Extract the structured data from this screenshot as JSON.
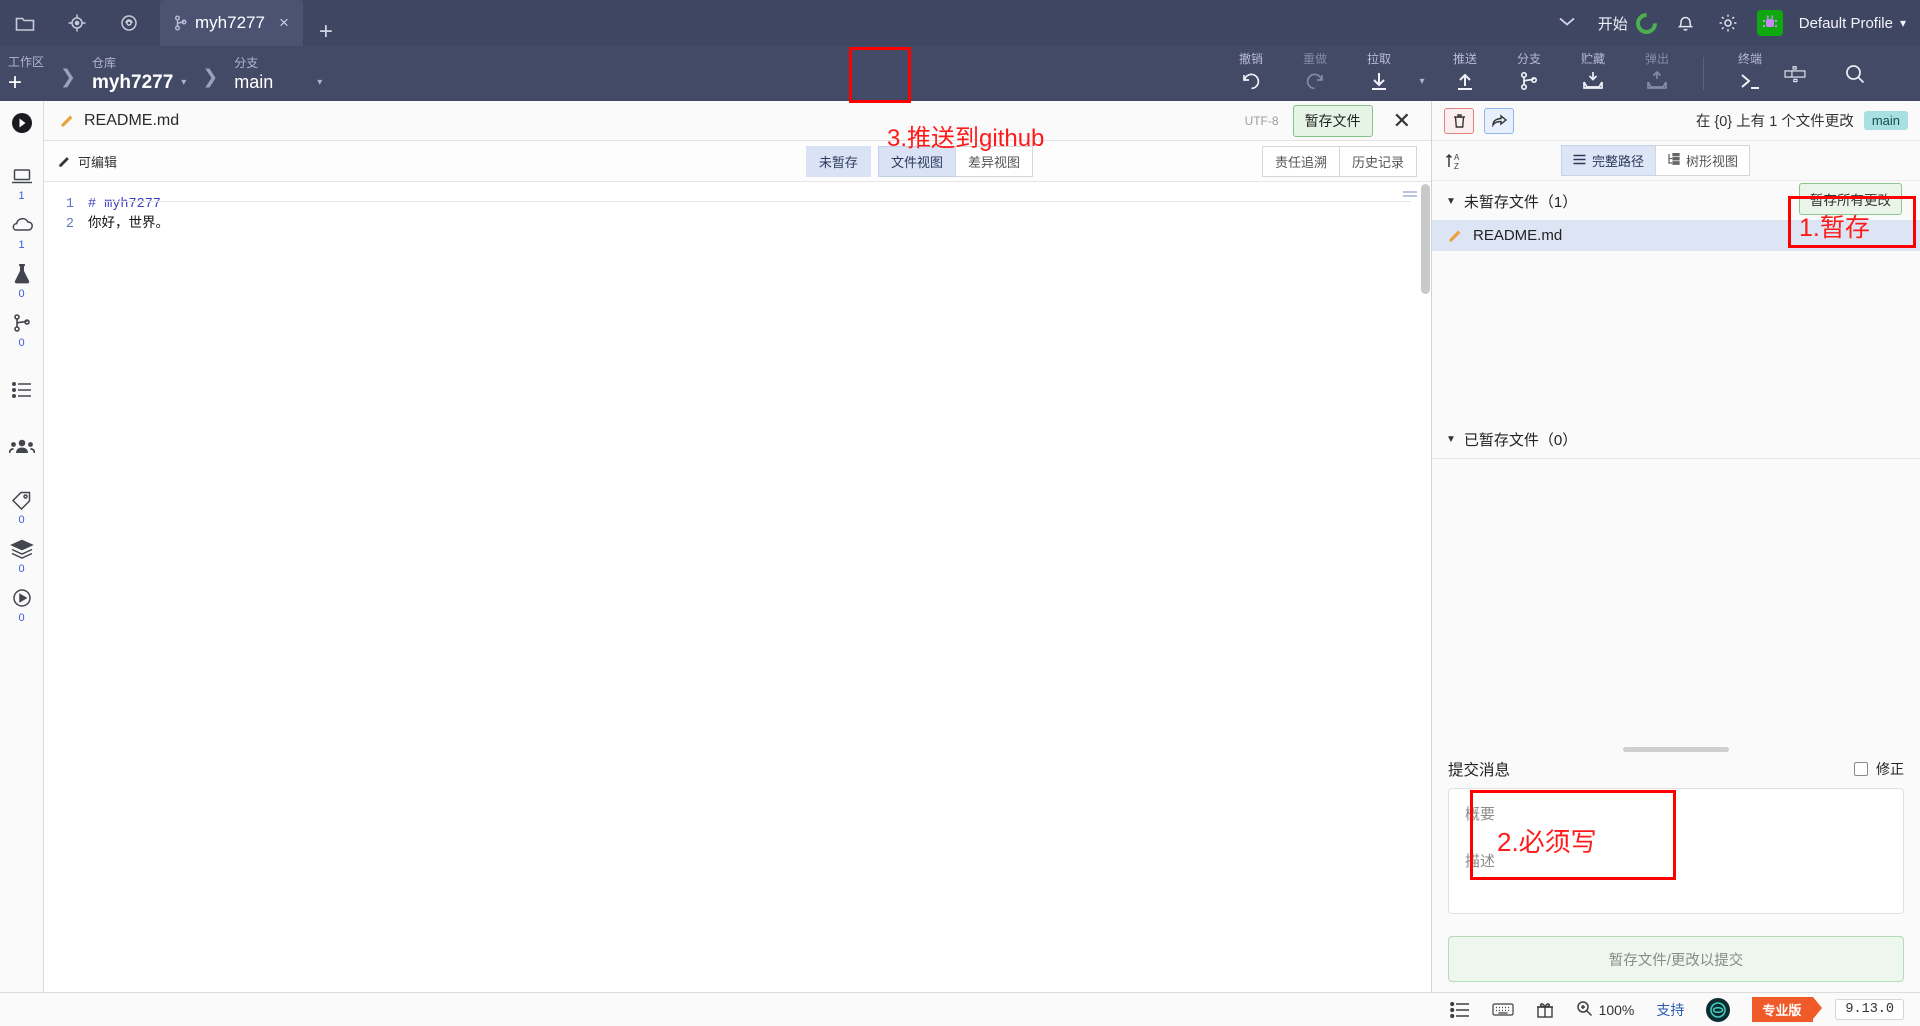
{
  "titlebar": {
    "icons": [
      "folder-icon",
      "target-icon",
      "cloud-sync-icon"
    ],
    "tab": {
      "label": "myh7277",
      "close": "×"
    },
    "newtab": "+",
    "chevron": "⌄",
    "start_label": "开始",
    "profile_label": "Default Profile",
    "profile_caret": "▾"
  },
  "toolbar": {
    "workspace_label": "工作区",
    "repo_label": "仓库",
    "repo_value": "myh7277",
    "branch_label": "分支",
    "branch_value": "main",
    "plus": "+",
    "actions": [
      {
        "label": "撤销",
        "name": "undo",
        "enabled": true
      },
      {
        "label": "重做",
        "name": "redo",
        "enabled": false
      },
      {
        "label": "拉取",
        "name": "pull",
        "enabled": true
      },
      {
        "label": "推送",
        "name": "push",
        "enabled": true
      },
      {
        "label": "分支",
        "name": "branch",
        "enabled": true
      },
      {
        "label": "贮藏",
        "name": "stash",
        "enabled": true
      },
      {
        "label": "弹出",
        "name": "pop",
        "enabled": false
      },
      {
        "label": "终端",
        "name": "terminal",
        "enabled": true
      }
    ]
  },
  "rail": [
    {
      "name": "play-circle-icon",
      "count": null
    },
    {
      "name": "laptop-icon",
      "count": "1"
    },
    {
      "name": "cloud-icon",
      "count": "1"
    },
    {
      "name": "flask-icon",
      "count": "0"
    },
    {
      "name": "branch-icon",
      "count": "0"
    },
    {
      "name": "list-icon",
      "count": null
    },
    {
      "name": "people-icon",
      "count": null
    },
    {
      "name": "tag-icon",
      "count": "0"
    },
    {
      "name": "stack-icon",
      "count": "0"
    },
    {
      "name": "play-icon",
      "count": "0"
    }
  ],
  "editor": {
    "filename": "README.md",
    "encoding": "UTF-8",
    "stage_button": "暂存文件",
    "close": "✕",
    "editable_label": "可编辑",
    "view_tabs": [
      {
        "label": "未暂存",
        "active": true,
        "style": "plain"
      },
      {
        "label": "文件视图",
        "active": true,
        "style": "seg"
      },
      {
        "label": "差异视图",
        "active": false,
        "style": "seg"
      }
    ],
    "right_tabs": [
      {
        "label": "责任追溯",
        "active": false
      },
      {
        "label": "历史记录",
        "active": false
      }
    ],
    "lines": [
      {
        "num": "1",
        "text": "# myh7277",
        "kind": "heading"
      },
      {
        "num": "2",
        "text": "你好，世界。",
        "kind": "text"
      }
    ]
  },
  "right_panel": {
    "delete_icon": "trash-icon",
    "share_icon": "share-arrow-icon",
    "status_text": "在 {0} 上有 1 个文件更改",
    "branch_chip": "main",
    "sort_icon": "sort-az-icon",
    "view_tabs": [
      {
        "label": "完整路径",
        "active": true,
        "icon": "list-lines-icon"
      },
      {
        "label": "树形视图",
        "active": false,
        "icon": "tree-icon"
      }
    ],
    "stage_all_button": "暂存所有更改",
    "unstaged_group": "未暂存文件（1）",
    "unstaged_files": [
      {
        "name": "README.md",
        "icon": "pencil-icon"
      }
    ],
    "staged_group": "已暂存文件（0）",
    "staged_files": [],
    "commit_title": "提交消息",
    "amend_label": "修正",
    "summary_placeholder": "概要",
    "description_placeholder": "描述",
    "commit_button": "暂存文件/更改以提交"
  },
  "statusbar": {
    "zoom": "100%",
    "support": "支持",
    "pro": "专业版",
    "version": "9.13.0",
    "icons": [
      "list-icon",
      "keyboard-icon",
      "gift-icon",
      "zoom-in-icon",
      "gitkraken-logo"
    ]
  },
  "annotations": [
    {
      "id": "a1",
      "text": "1.暂存",
      "kind": "box-with-text"
    },
    {
      "id": "a2",
      "text": "2.必须写",
      "kind": "box-with-text"
    },
    {
      "id": "a3",
      "text": "3.推送到github",
      "kind": "text"
    },
    {
      "id": "a4",
      "text": "",
      "kind": "box"
    }
  ],
  "colors": {
    "accent_red": "#ff0000",
    "chrome": "#3f4661",
    "toolbar": "#434a66",
    "green_btn": "#eaf5ea",
    "branch_chip": "#a8dfe0",
    "pro_orange": "#f05a28"
  }
}
